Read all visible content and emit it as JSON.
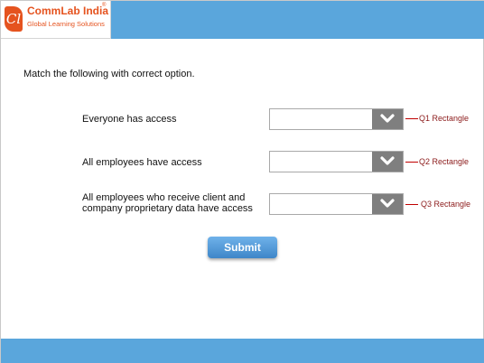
{
  "brand": {
    "logo_mark": "Cl",
    "name": "CommLab India",
    "registered": "®",
    "tagline": "Global Learning Solutions"
  },
  "colors": {
    "bar_blue": "#5aa6dc",
    "brand_orange": "#e5531f",
    "dropdown_button": "#7f7f7f",
    "callout_red": "#c00000"
  },
  "instruction": "Match the following with correct option.",
  "questions": [
    {
      "label": "Everyone has access",
      "selected_value": "",
      "callout": "Q1 Rectangle"
    },
    {
      "label": "All employees have access",
      "selected_value": "",
      "callout": "Q2 Rectangle"
    },
    {
      "label_line1": "All employees who receive client and",
      "label_line2": "company proprietary data have access",
      "selected_value": "",
      "callout": "Q3 Rectangle"
    }
  ],
  "submit_label": "Submit",
  "icons": {
    "dropdown": "chevron-down-icon"
  }
}
